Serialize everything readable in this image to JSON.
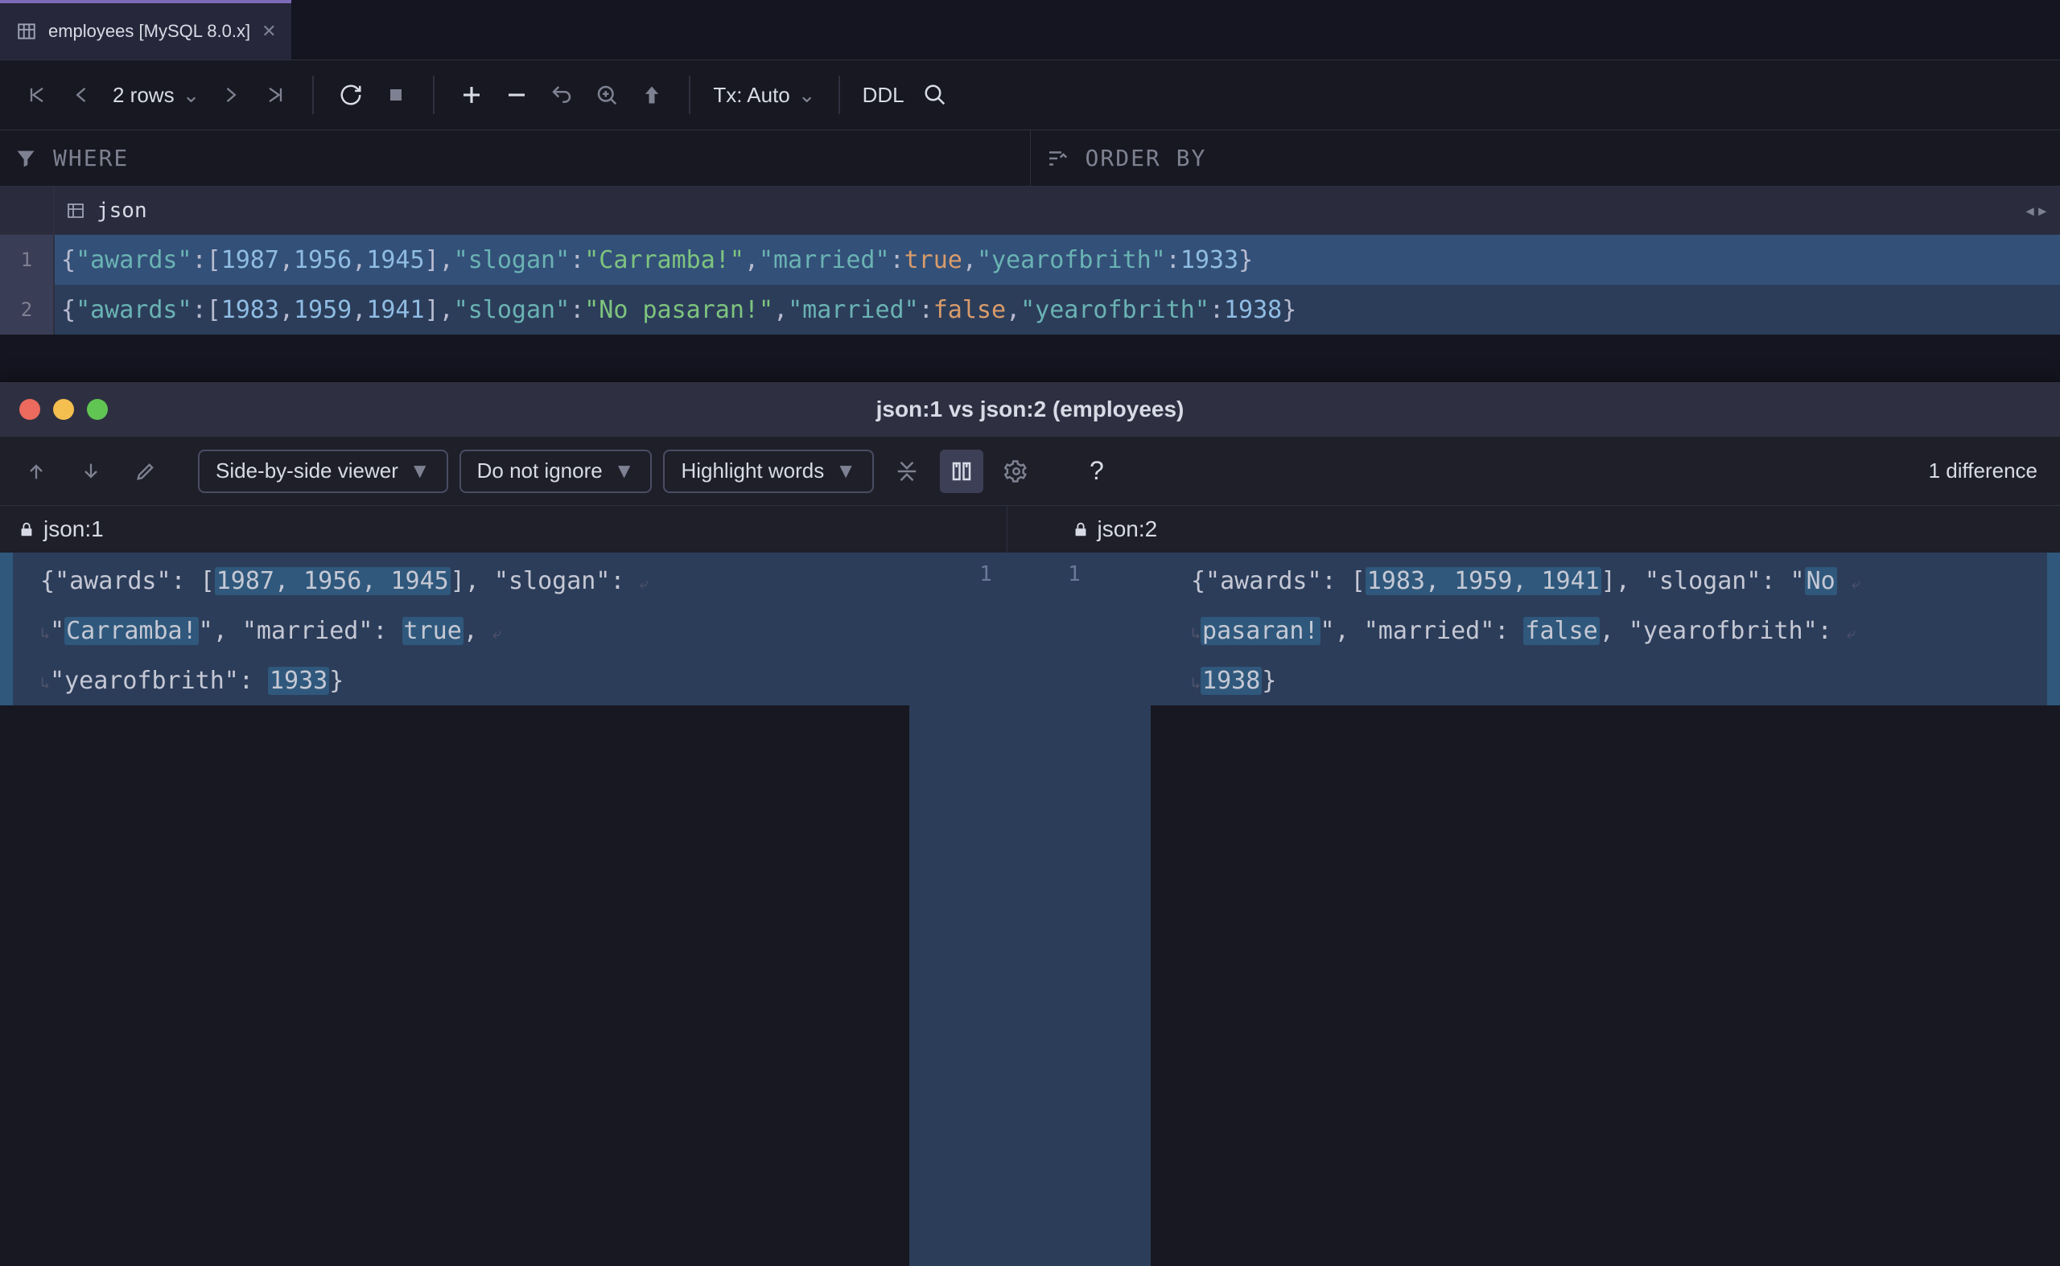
{
  "tab": {
    "title": "employees [MySQL 8.0.x]"
  },
  "toolbar": {
    "rows_label": "2 rows",
    "tx_label": "Tx: Auto",
    "ddl_label": "DDL"
  },
  "filters": {
    "where": "WHERE",
    "order_by": "ORDER BY"
  },
  "column": {
    "name": "json"
  },
  "rows": [
    {
      "n": "1",
      "json": {
        "awards": [
          1987,
          1956,
          1945
        ],
        "slogan": "Carramba!",
        "married": true,
        "yearofbrith": 1933
      }
    },
    {
      "n": "2",
      "json": {
        "awards": [
          1983,
          1959,
          1941
        ],
        "slogan": "No pasaran!",
        "married": false,
        "yearofbrith": 1938
      }
    }
  ],
  "diff": {
    "title": "json:1 vs json:2 (employees)",
    "viewer_mode": "Side-by-side viewer",
    "ignore_mode": "Do not ignore",
    "highlight_mode": "Highlight words",
    "diff_count": "1 difference",
    "left_label": "json:1",
    "right_label": "json:2",
    "gutter_left": "1",
    "gutter_right": "1",
    "left_lines": [
      "{\"awards\": [1987, 1956, 1945], \"slogan\":",
      "\"Carramba!\", \"married\": true,",
      "\"yearofbrith\": 1933}"
    ],
    "right_lines": [
      "{\"awards\": [1983, 1959, 1941], \"slogan\": \"No",
      "pasaran!\", \"married\": false, \"yearofbrith\":",
      "1938}"
    ],
    "left_highlights": [
      "1987, 1956, 1945",
      "Carramba!",
      "true",
      "1933"
    ],
    "right_highlights": [
      "1983, 1959, 1941",
      "No",
      "pasaran!",
      "false",
      "1938"
    ]
  }
}
